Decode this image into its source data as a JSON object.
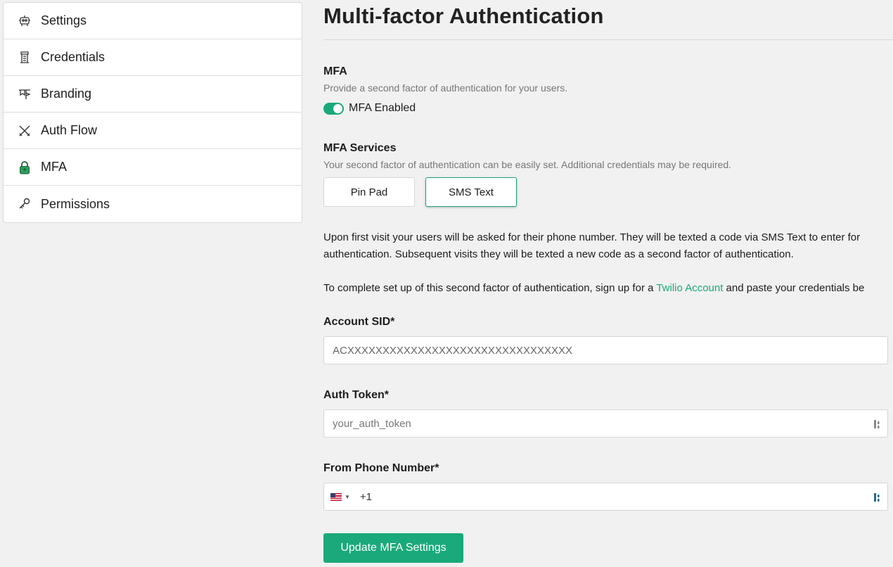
{
  "sidebar": {
    "items": [
      {
        "label": "Settings",
        "icon": "robot-icon"
      },
      {
        "label": "Credentials",
        "icon": "tower-icon"
      },
      {
        "label": "Branding",
        "icon": "banner-icon"
      },
      {
        "label": "Auth Flow",
        "icon": "crossed-swords-icon"
      },
      {
        "label": "MFA",
        "icon": "lock-icon"
      },
      {
        "label": "Permissions",
        "icon": "key-icon"
      }
    ]
  },
  "main": {
    "title": "Multi-factor Authentication",
    "mfa": {
      "title": "MFA",
      "description": "Provide a second factor of authentication for your users.",
      "toggle_label": "MFA Enabled",
      "enabled": true
    },
    "services": {
      "title": "MFA Services",
      "description": "Your second factor of authentication can be easily set. Additional credentials may be required.",
      "options": [
        "Pin Pad",
        "SMS Text"
      ],
      "selected": "SMS Text"
    },
    "paragraph1": "Upon first visit your users will be asked for their phone number. They will be texted a code via SMS Text to enter for authentication. Subsequent visits they will be texted a new code as a second factor of authentication.",
    "paragraph1_line1": "Upon first visit your users will be asked for their phone number. They will be texted a code via SMS Text to enter for",
    "paragraph1_line2": "authentication. Subsequent visits they will be texted a new code as a second factor of authentication.",
    "paragraph2_before": "To complete set up of this second factor of authentication, sign up for a ",
    "paragraph2_link": "Twilio Account",
    "paragraph2_after": " and paste your credentials be",
    "fields": {
      "account_sid_label": "Account SID*",
      "account_sid_placeholder": "ACXXXXXXXXXXXXXXXXXXXXXXXXXXXXXXXX",
      "auth_token_label": "Auth Token*",
      "auth_token_placeholder": "your_auth_token",
      "phone_label": "From Phone Number*",
      "phone_prefix": "+1"
    },
    "submit_label": "Update MFA Settings"
  },
  "colors": {
    "accent": "#1aa97a",
    "background": "#f1f1f1"
  }
}
